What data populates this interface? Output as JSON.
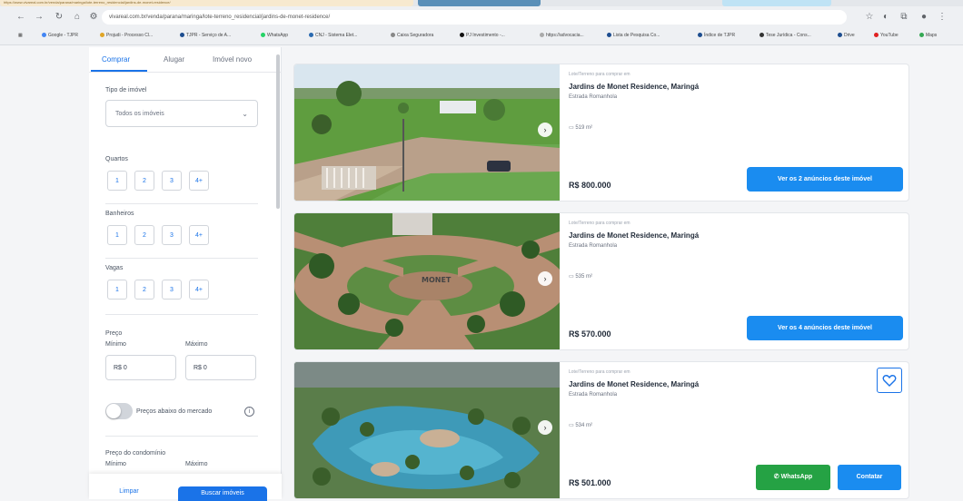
{
  "browser": {
    "tab_url_text": "https://www.vivareal.com.br/venda/parana/maringa/lote-terreno_residencial/jardins-de-monet-residence/",
    "url": "vivareal.com.br/venda/parana/maringa/lote-terreno_residencial/jardins-de-monet-residence/",
    "bookmarks": [
      {
        "label": "Google - TJPR"
      },
      {
        "label": "Projudi - Processo Cl..."
      },
      {
        "label": "TJPR - Serviço de A..."
      },
      {
        "label": "WhatsApp"
      },
      {
        "label": "CNJ - Sistema Elet..."
      },
      {
        "label": "Caixa Seguradora"
      },
      {
        "label": "PJ Investimento -..."
      },
      {
        "label": "https://advocacia..."
      },
      {
        "label": "Lista de Pesquisa Co..."
      },
      {
        "label": "Índice de TJPR"
      },
      {
        "label": "Tese Jurídica - Cons..."
      },
      {
        "label": "Drive"
      },
      {
        "label": "YouTube"
      },
      {
        "label": "Maps"
      }
    ]
  },
  "sidebar": {
    "tabs": [
      "Comprar",
      "Alugar",
      "Imóvel novo"
    ],
    "property_type": {
      "label": "Tipo de imóvel",
      "value": "Todos os imóveis"
    },
    "bedrooms": {
      "label": "Quartos",
      "options": [
        "1",
        "2",
        "3",
        "4+"
      ]
    },
    "bathrooms": {
      "label": "Banheiros",
      "options": [
        "1",
        "2",
        "3",
        "4+"
      ]
    },
    "parking": {
      "label": "Vagas",
      "options": [
        "1",
        "2",
        "3",
        "4+"
      ]
    },
    "price": {
      "label": "Preço",
      "min_label": "Mínimo",
      "max_label": "Máximo",
      "min_value": "R$ 0",
      "max_value": "R$ 0"
    },
    "below_market": {
      "label": "Preços abaixo do mercado"
    },
    "condo_price": {
      "label": "Preço do condomínio",
      "min_label": "Mínimo",
      "max_label": "Máximo"
    },
    "clear_label": "Limpar",
    "search_label": "Buscar imóveis"
  },
  "listings": [
    {
      "type": "Lote/Terreno para comprar em",
      "title": "Jardins de Monet Residence, Maringá",
      "subtitle": "Estrada Romanhola",
      "area": "519 m²",
      "price": "R$ 800.000",
      "button": "Ver os 2 anúncios deste imóvel"
    },
    {
      "type": "Lote/Terreno para comprar em",
      "title": "Jardins de Monet Residence, Maringá",
      "subtitle": "Estrada Romanhola",
      "area": "535 m²",
      "price": "R$ 570.000",
      "button": "Ver os 4 anúncios deste imóvel"
    },
    {
      "type": "Lote/Terreno para comprar em",
      "title": "Jardins de Monet Residence, Maringá",
      "subtitle": "Estrada Romanhola",
      "area": "534 m²",
      "price": "R$ 501.000",
      "whatsapp": "WhatsApp",
      "contact": "Contatar"
    }
  ]
}
